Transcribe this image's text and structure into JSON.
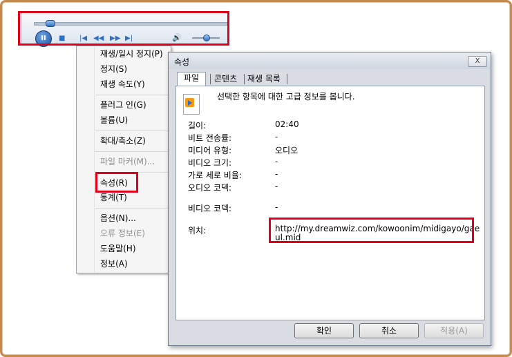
{
  "player": {
    "pause_icon": "II",
    "stop_icon": "■",
    "prev_icon": "|◀",
    "rewind_icon": "◀◀",
    "forward_icon": "▶▶",
    "next_icon": "▶|",
    "volume_icon": "🔊",
    "seek_position": 0.06,
    "volume_level": 0.5
  },
  "menu": {
    "items": [
      {
        "label": "재생/일시 정지(P)",
        "disabled": false
      },
      {
        "label": "정지(S)",
        "disabled": false
      },
      {
        "label": "재생 속도(Y)",
        "disabled": false
      },
      {
        "label": "플러그 인(G)",
        "disabled": false
      },
      {
        "label": "볼륨(U)",
        "disabled": false
      },
      {
        "label": "확대/축소(Z)",
        "disabled": false
      },
      {
        "label": "파일 마커(M)...",
        "disabled": true
      },
      {
        "label": "속성(R)",
        "disabled": false
      },
      {
        "label": "통계(T)",
        "disabled": false
      },
      {
        "label": "옵션(N)...",
        "disabled": false
      },
      {
        "label": "오류 정보(E)",
        "disabled": true
      },
      {
        "label": "도움말(H)",
        "disabled": false
      },
      {
        "label": "정보(A)",
        "disabled": false
      }
    ]
  },
  "dialog": {
    "title": "속성",
    "close_label": "X",
    "tabs": [
      "파일",
      "콘텐츠",
      "재생 목록"
    ],
    "description": "선택한 항목에 대한 고급 정보를 봅니다.",
    "properties": [
      {
        "label": "길이:",
        "value": "02:40"
      },
      {
        "label": "비트 전송률:",
        "value": "-"
      },
      {
        "label": "미디어 유형:",
        "value": "오디오"
      },
      {
        "label": "비디오 크기:",
        "value": "-"
      },
      {
        "label": "가로 세로 비율:",
        "value": "-"
      },
      {
        "label": "오디오 코덱:",
        "value": "-"
      },
      {
        "label": "비디오 코덱:",
        "value": "-"
      }
    ],
    "location_label": "위치:",
    "location_value": "http://my.dreamwiz.com/kowoonim/midigayo/gaeul.mid",
    "buttons": {
      "ok": "확인",
      "cancel": "취소",
      "apply": "적용(A)"
    }
  },
  "colors": {
    "highlight": "#e0001b",
    "frame": "#c58a4e"
  }
}
